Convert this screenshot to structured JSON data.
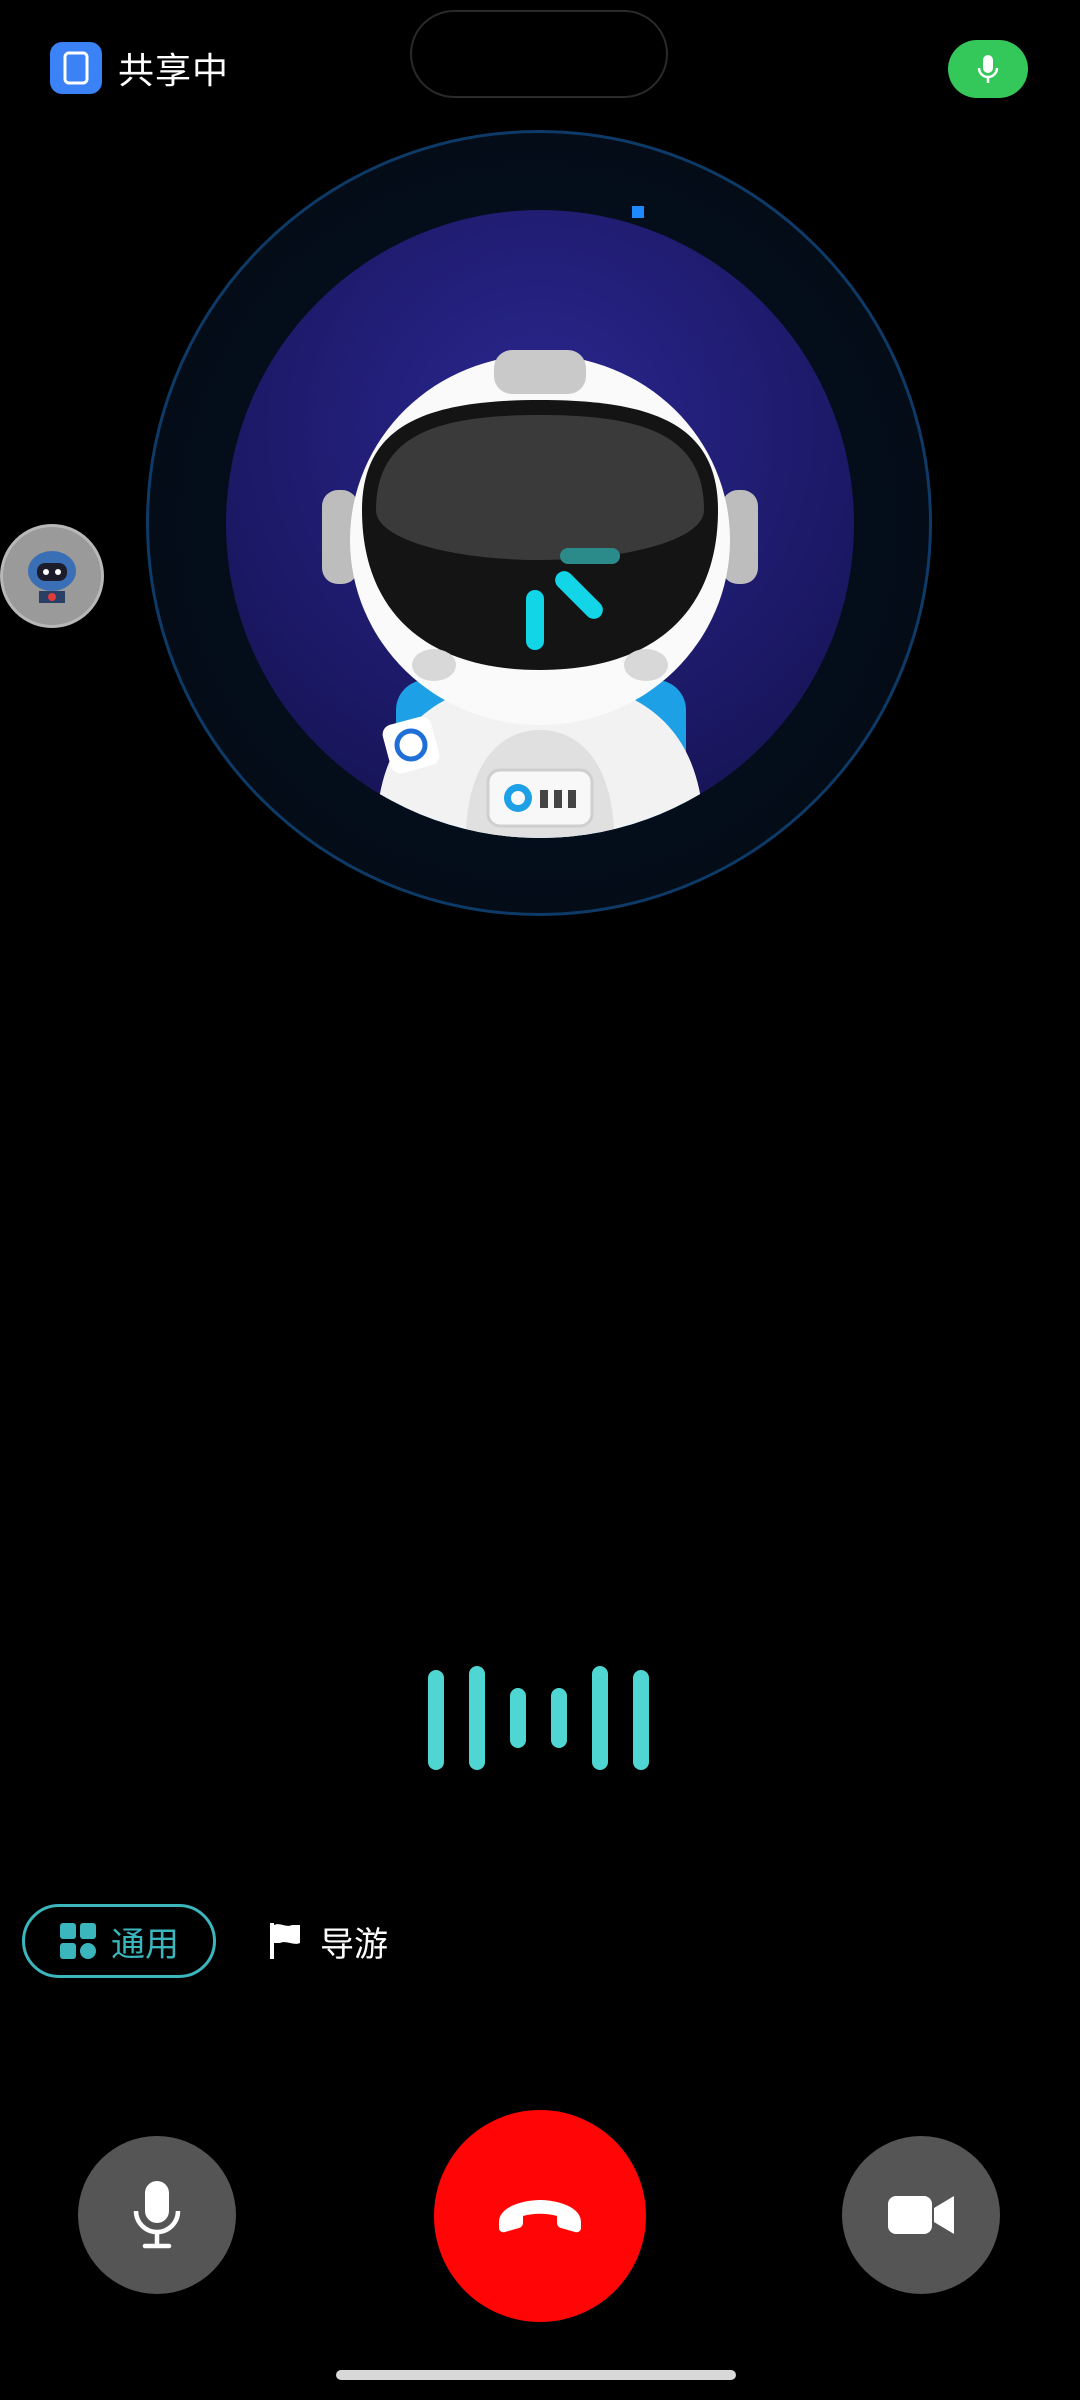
{
  "status_bar": {
    "share_label": "共享中",
    "share_icon": "screen-share-icon",
    "mic_indicator_icon": "microphone-icon",
    "mic_indicator_color": "#34c759"
  },
  "avatar": {
    "description_icon": "astronaut-robot-icon",
    "ring_color": "#0d3a66",
    "inner_color": "#1d1a6a"
  },
  "side_assistant": {
    "icon": "robot-assistant-icon"
  },
  "voice_wave": {
    "color": "#4fd6d3",
    "levels": [
      0.62,
      0.62,
      0.38,
      0.38,
      0.62,
      0.62
    ]
  },
  "modes": {
    "general_label": "通用",
    "general_icon": "grid-icon",
    "guide_label": "导游",
    "guide_icon": "flag-icon",
    "active_color": "#3bb6bd"
  },
  "controls": {
    "mic_icon": "microphone-icon",
    "hangup_icon": "phone-hangup-icon",
    "hangup_color": "#ff0505",
    "video_icon": "video-camera-icon"
  }
}
